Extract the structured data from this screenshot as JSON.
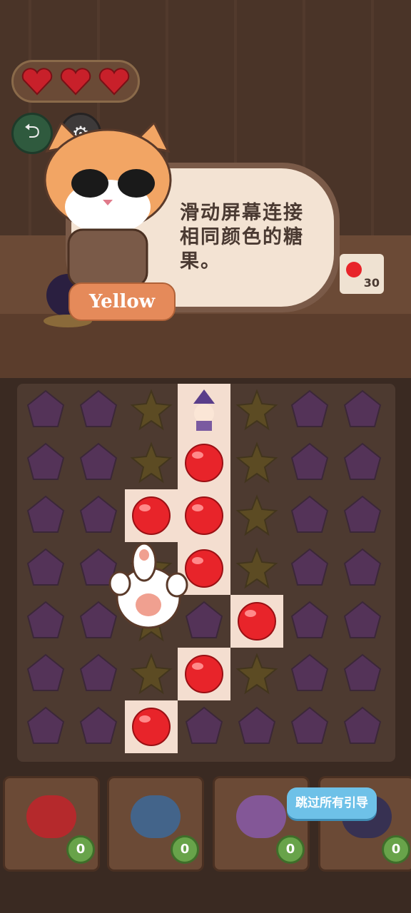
{
  "hud": {
    "hearts": 3,
    "back_icon": "back-icon",
    "settings_icon": "gear-icon"
  },
  "dialog": {
    "speaker": "Yellow",
    "text": "滑动屏幕连接相同颜色的糖果。"
  },
  "level_counter": "30",
  "board": {
    "rows": 7,
    "cols": 7,
    "grid": [
      [
        "purple",
        "purple",
        "yellow",
        "witch",
        "yellow",
        "purple",
        "purple"
      ],
      [
        "purple",
        "purple",
        "yellow",
        "red",
        "yellow",
        "purple",
        "purple"
      ],
      [
        "purple",
        "purple",
        "red",
        "red",
        "yellow",
        "purple",
        "purple"
      ],
      [
        "purple",
        "purple",
        "yellow",
        "red",
        "yellow",
        "purple",
        "purple"
      ],
      [
        "purple",
        "purple",
        "yellow",
        "purple",
        "red",
        "purple",
        "purple"
      ],
      [
        "purple",
        "purple",
        "yellow",
        "red",
        "yellow",
        "purple",
        "purple"
      ],
      [
        "purple",
        "purple",
        "red",
        "purple",
        "purple",
        "purple",
        "purple"
      ]
    ],
    "highlighted": [
      [
        0,
        3
      ],
      [
        1,
        3
      ],
      [
        2,
        2
      ],
      [
        2,
        3
      ],
      [
        3,
        3
      ],
      [
        4,
        4
      ],
      [
        5,
        3
      ],
      [
        6,
        2
      ]
    ]
  },
  "tools": [
    {
      "name": "heart",
      "count": "0"
    },
    {
      "name": "shuffle",
      "count": "0"
    },
    {
      "name": "hammer",
      "count": "0"
    },
    {
      "name": "bomb",
      "count": "0"
    }
  ],
  "skip_button": "跳过所有引导",
  "colors": {
    "purple": "#5a2e7a",
    "yellow": "#6a5a1a",
    "red": "#e8242a",
    "highlight": "#f4ded0"
  }
}
